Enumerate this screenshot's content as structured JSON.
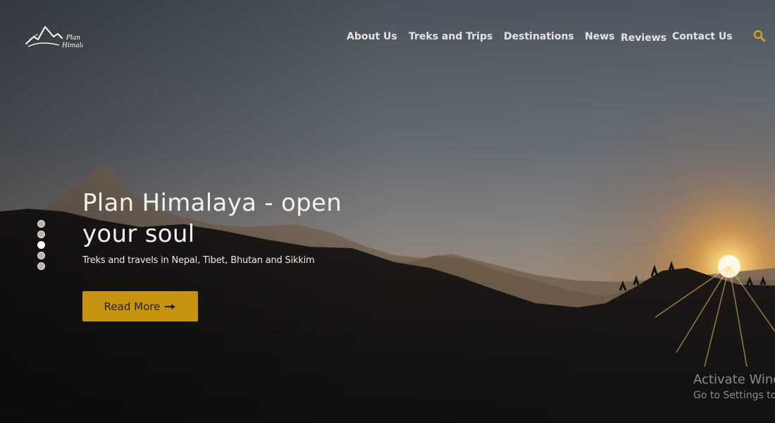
{
  "brand": {
    "logo_line1": "Plan",
    "logo_line2": "Himalaya"
  },
  "nav": {
    "items": [
      {
        "label": "About Us"
      },
      {
        "label": "Treks and Trips"
      },
      {
        "label": "Destinations"
      },
      {
        "label": "News"
      },
      {
        "label": "Reviews"
      },
      {
        "label": "Contact Us"
      }
    ],
    "search_icon": "search-icon"
  },
  "hero": {
    "title": "Plan Himalaya - open your soul",
    "subtitle": "Treks and travels in Nepal, Tibet, Bhutan and Sikkim",
    "cta_label": "Read More",
    "cta_icon": "arrow-right-icon"
  },
  "slider": {
    "slide_count": 5,
    "active_slide": 3
  },
  "system_watermark": {
    "title": "Activate Wind",
    "subtitle": "Go to Settings to"
  },
  "colors": {
    "accent": "#c6930f",
    "search_icon": "#e1a615",
    "nav_text": "#e4e3e1"
  }
}
